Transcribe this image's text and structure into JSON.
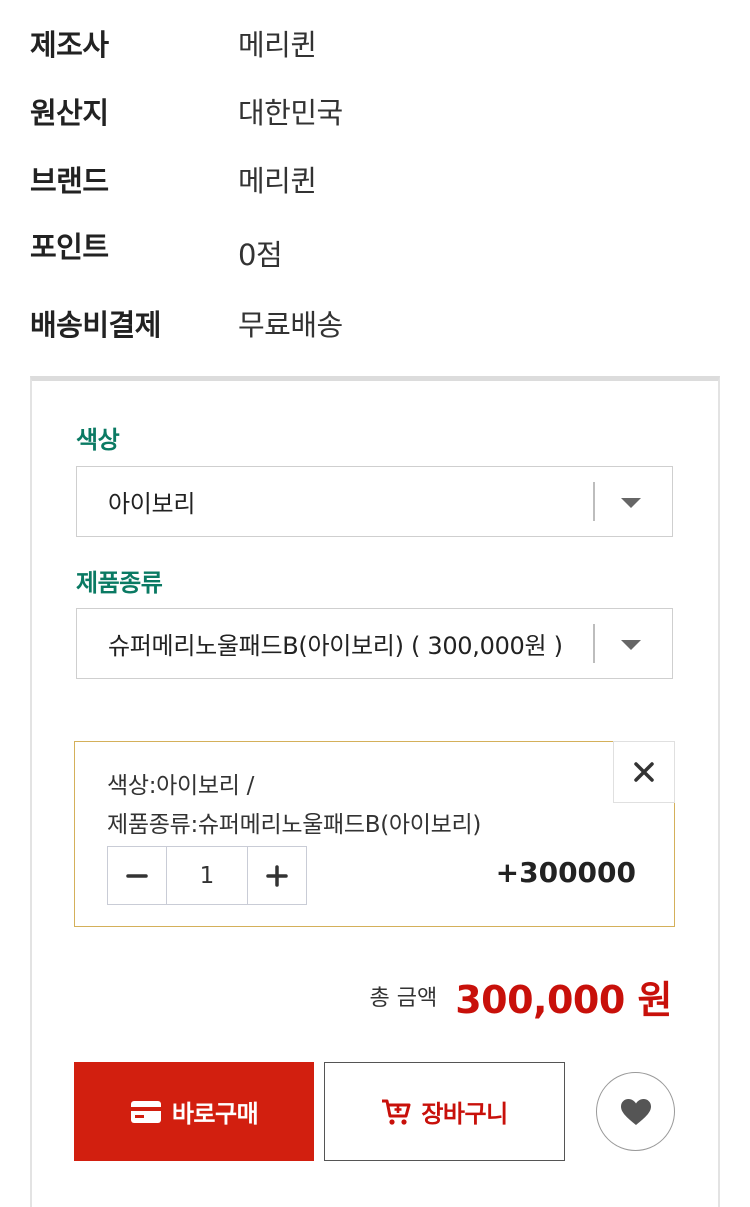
{
  "product_info": [
    {
      "label": "제조사",
      "value": "메리퀸"
    },
    {
      "label": "원산지",
      "value": "대한민국"
    },
    {
      "label": "브랜드",
      "value": "메리퀸"
    },
    {
      "label": "포인트",
      "value": "0점"
    },
    {
      "label": "배송비결제",
      "value": "무료배송"
    }
  ],
  "options": {
    "color": {
      "label": "색상",
      "selected": "아이보리"
    },
    "product_type": {
      "label": "제품종류",
      "selected": "슈퍼메리노울패드B(아이보리) ( 300,000원 )"
    }
  },
  "selected_item": {
    "line1": "색상:아이보리 /",
    "line2": "제품종류:슈퍼메리노울패드B(아이보리)",
    "quantity": "1",
    "price": "+300000"
  },
  "total": {
    "label": "총 금액",
    "value": "300,000 원"
  },
  "buttons": {
    "buy": "바로구매",
    "cart": "장바구니"
  },
  "colors": {
    "accent_green": "#0a7a63",
    "buy_red": "#d21f0f",
    "price_red": "#c8100a",
    "selected_border": "#d4b05a"
  },
  "icons": {
    "buy": "card-icon",
    "cart": "cart-plus-icon",
    "wish": "heart-icon",
    "remove": "close-icon"
  }
}
